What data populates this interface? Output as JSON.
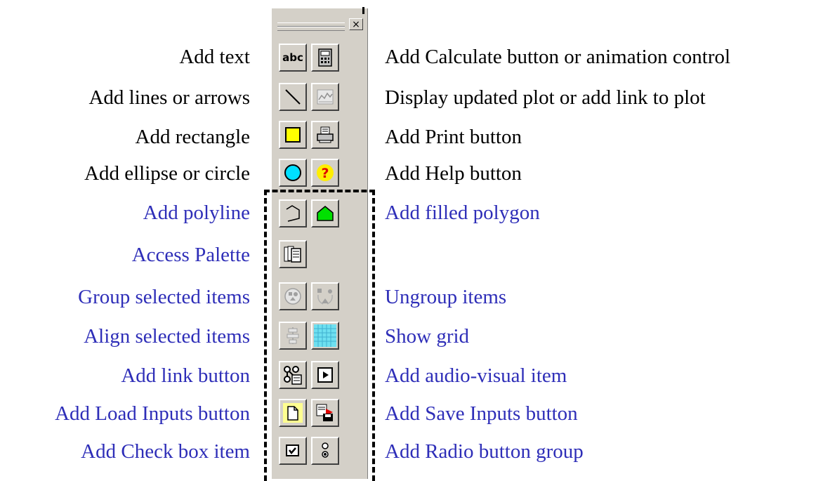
{
  "close_glyph": "×",
  "left_labels": [
    "Add text",
    "Add lines or arrows",
    "Add rectangle",
    "Add ellipse or circle",
    "Add polyline",
    "Access Palette",
    "Group selected items",
    "Align selected items",
    "Add link button",
    "Add Load Inputs button",
    "Add Check box item"
  ],
  "right_labels": [
    "Add Calculate button or animation control",
    "Display updated plot or add link to plot",
    "Add Print button",
    "Add Help button",
    "Add filled polygon",
    "Ungroup items",
    "Show grid",
    "Add audio-visual item",
    "Add Save Inputs button",
    "Add Radio button group"
  ],
  "buttons": {
    "text_tool_glyph": "abc"
  },
  "colors": {
    "label_black": "#000000",
    "label_blue": "#2e2eb8",
    "palette_bg": "#d4d0c8",
    "rectangle_fill": "#ffff00",
    "circle_fill": "#00e0ff",
    "polygon_fill": "#00e000",
    "grid_fill": "#6ee0f0"
  },
  "icons": [
    "text-tool-icon",
    "calculator-icon",
    "line-tool-icon",
    "plot-icon",
    "rectangle-tool-icon",
    "print-icon",
    "ellipse-tool-icon",
    "help-icon",
    "polyline-tool-icon",
    "filled-polygon-icon",
    "palette-icon",
    "group-icon",
    "ungroup-icon",
    "align-icon",
    "grid-icon",
    "link-button-icon",
    "audio-visual-icon",
    "load-inputs-icon",
    "save-inputs-icon",
    "checkbox-icon",
    "radio-group-icon"
  ]
}
